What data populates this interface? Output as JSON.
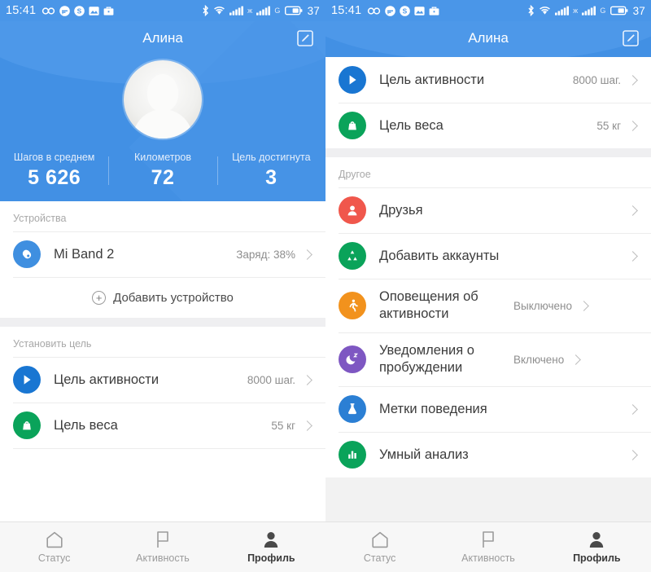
{
  "statusbar": {
    "time": "15:41",
    "left_icons": [
      "infinity-icon",
      "messenger-icon",
      "skype-icon",
      "photo-icon",
      "briefcase-icon"
    ],
    "right_icons": [
      "bluetooth-icon",
      "wifi-icon",
      "signal-1-icon",
      "roaming-icon",
      "signal-2-icon",
      "g-network-icon",
      "battery-icon"
    ],
    "battery_level": "37"
  },
  "header": {
    "title": "Алина",
    "edit_icon": "edit-icon",
    "avatar": "avatar"
  },
  "stats": [
    {
      "label": "Шагов в среднем",
      "value": "5 626"
    },
    {
      "label": "Километров",
      "value": "72"
    },
    {
      "label": "Цель достигнута",
      "value": "3"
    }
  ],
  "left": {
    "devices_section_title": "Устройства",
    "devices": [
      {
        "icon": "mi-band-icon",
        "label": "Mi Band 2",
        "value": "Заряд: 38%",
        "color": "#3f8fe0"
      }
    ],
    "add_device_label": "Добавить устройство",
    "goals_section_title": "Установить цель",
    "goals": [
      {
        "icon": "activity-goal-icon",
        "label": "Цель активности",
        "value": "8000 шаг.",
        "color": "#1976d2"
      },
      {
        "icon": "weight-goal-icon",
        "label": "Цель веса",
        "value": "55 кг",
        "color": "#0aa35a"
      }
    ]
  },
  "right": {
    "goals": [
      {
        "icon": "activity-goal-icon",
        "label": "Цель активности",
        "value": "8000 шаг.",
        "color": "#1976d2"
      },
      {
        "icon": "weight-goal-icon",
        "label": "Цель веса",
        "value": "55 кг",
        "color": "#0aa35a"
      }
    ],
    "other_section_title": "Другое",
    "other": [
      {
        "icon": "friends-icon",
        "label": "Друзья",
        "value": "",
        "color": "#f0574c"
      },
      {
        "icon": "add-accounts-icon",
        "label": "Добавить аккаунты",
        "value": "",
        "color": "#0aa35a"
      },
      {
        "icon": "activity-alerts-icon",
        "label": "Оповещения об активности",
        "value": "Выключено",
        "color": "#f2921d"
      },
      {
        "icon": "wake-notifications-icon",
        "label": "Уведомления о пробуждении",
        "value": "Включено",
        "color": "#7e57c2"
      },
      {
        "icon": "behavior-tags-icon",
        "label": "Метки поведения",
        "value": "",
        "color": "#2b7fd4"
      },
      {
        "icon": "smart-analysis-icon",
        "label": "Умный анализ",
        "value": "",
        "color": "#0aa35a"
      }
    ]
  },
  "tabs": [
    {
      "icon": "home-icon",
      "label": "Статус",
      "active": false
    },
    {
      "icon": "flag-icon",
      "label": "Активность",
      "active": false
    },
    {
      "icon": "person-icon",
      "label": "Профиль",
      "active": true
    }
  ],
  "colors": {
    "header_blue": "#4290e4",
    "statusbar_blue": "#4a96e8",
    "page_bg": "#efeff1",
    "accent_green": "#0aa35a"
  }
}
